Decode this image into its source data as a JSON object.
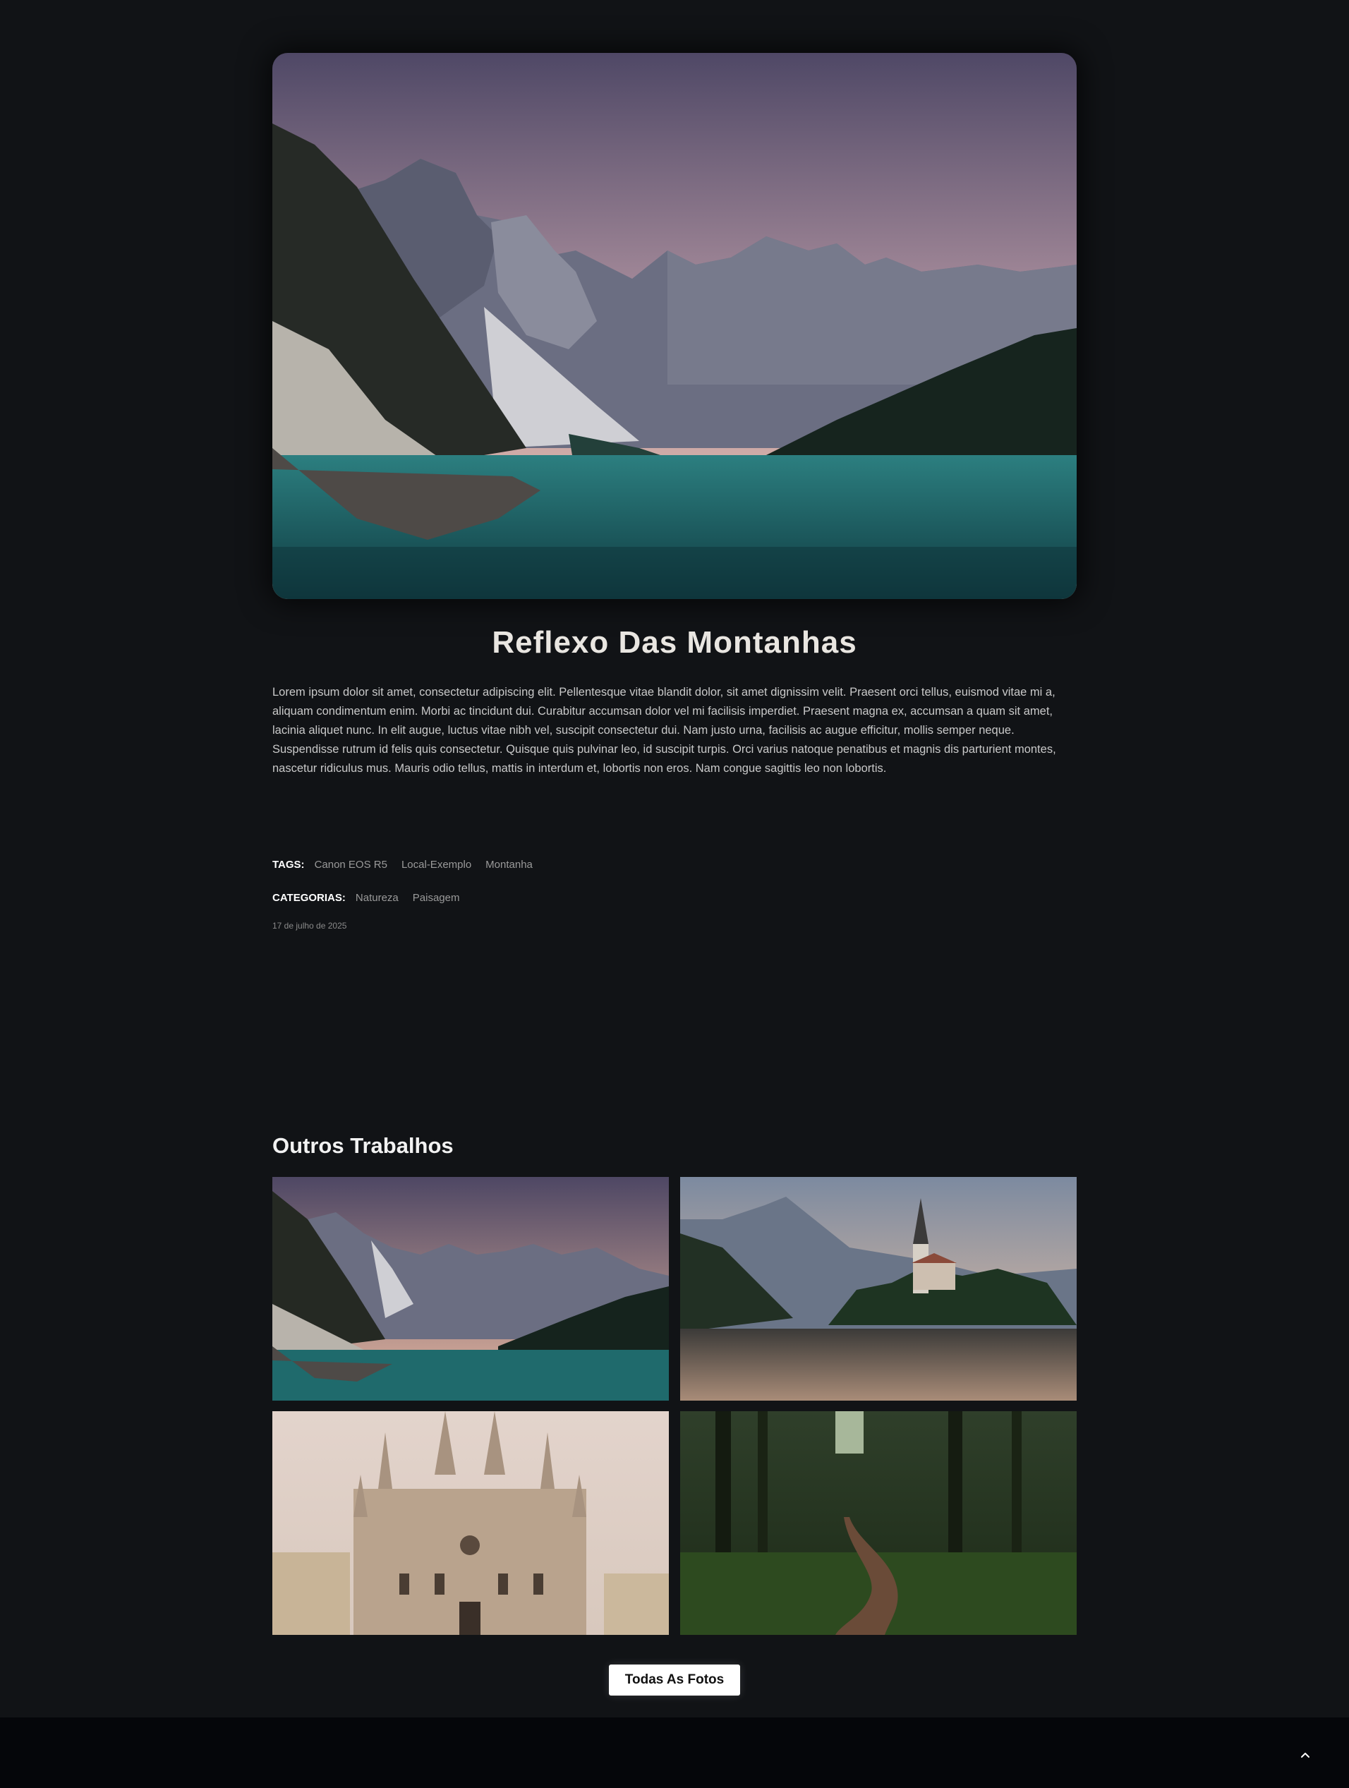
{
  "post": {
    "title": "Reflexo Das Montanhas",
    "description": "Lorem ipsum dolor sit amet, consectetur adipiscing elit. Pellentesque vitae blandit dolor, sit amet dignissim velit. Praesent orci tellus, euismod vitae mi a, aliquam condimentum enim. Morbi ac tincidunt dui. Curabitur accumsan dolor vel mi facilisis imperdiet. Praesent magna ex, accumsan a quam sit amet, lacinia aliquet nunc. In elit augue, luctus vitae nibh vel, suscipit consectetur dui. Nam justo urna, facilisis ac augue efficitur, mollis semper neque. Suspendisse rutrum id felis quis consectetur. Quisque quis pulvinar leo, id suscipit turpis. Orci varius natoque penatibus et magnis dis parturient montes, nascetur ridiculus mus. Mauris odio tellus, mattis in interdum et, lobortis non eros. Nam congue sagittis leo non lobortis.",
    "tags_label": "TAGS:",
    "tags": [
      "Canon EOS R5",
      "Local-Exemplo",
      "Montanha"
    ],
    "categories_label": "CATEGORIAS:",
    "categories": [
      "Natureza",
      "Paisagem"
    ],
    "date": "17 de julho de 2025"
  },
  "related": {
    "title": "Outros Trabalhos",
    "button_label": "Todas As Fotos"
  },
  "colors": {
    "background": "#111316",
    "footer": "#05060a",
    "button_bg": "#ffffff"
  },
  "icons": {
    "scroll_top": "chevron-up-icon"
  }
}
